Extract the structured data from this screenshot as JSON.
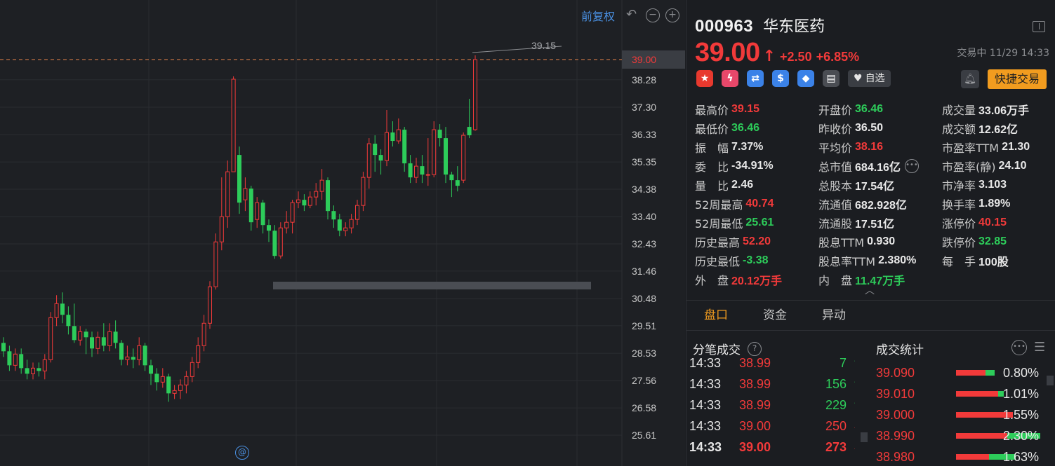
{
  "chart": {
    "adjust_label": "前复权",
    "undo_icon": "undo-icon",
    "zoom_out_icon": "zoom-out-icon",
    "zoom_in_icon": "zoom-in-icon",
    "marker_icon": "at-marker-icon",
    "high_annotation": "39.15",
    "last_price_label": "39.00",
    "colors": {
      "up": "#f23a3a",
      "down": "#2dcc5a",
      "grid": "#2a2c31",
      "dash": "#e8854a"
    },
    "axis_ticks": [
      "39.00",
      "38.28",
      "37.30",
      "36.33",
      "35.35",
      "34.38",
      "33.40",
      "32.43",
      "31.46",
      "30.48",
      "29.51",
      "28.53",
      "27.56",
      "26.58",
      "25.61"
    ]
  },
  "chart_data": {
    "type": "candlestick",
    "ylim": [
      25.61,
      39.15
    ],
    "candles": [
      {
        "o": 28.9,
        "c": 28.6,
        "h": 29.1,
        "l": 28.4
      },
      {
        "o": 28.6,
        "c": 28.1,
        "h": 28.8,
        "l": 27.9
      },
      {
        "o": 28.1,
        "c": 28.5,
        "h": 28.7,
        "l": 27.9
      },
      {
        "o": 28.5,
        "c": 28.0,
        "h": 28.7,
        "l": 27.8
      },
      {
        "o": 28.0,
        "c": 27.8,
        "h": 28.3,
        "l": 27.6
      },
      {
        "o": 27.8,
        "c": 28.0,
        "h": 28.2,
        "l": 27.6
      },
      {
        "o": 28.0,
        "c": 27.9,
        "h": 28.2,
        "l": 27.7
      },
      {
        "o": 27.9,
        "c": 28.3,
        "h": 28.5,
        "l": 27.6
      },
      {
        "o": 28.3,
        "c": 29.8,
        "h": 30.0,
        "l": 28.2
      },
      {
        "o": 29.8,
        "c": 30.3,
        "h": 30.6,
        "l": 29.5
      },
      {
        "o": 30.3,
        "c": 29.9,
        "h": 30.7,
        "l": 29.6
      },
      {
        "o": 29.9,
        "c": 29.5,
        "h": 30.2,
        "l": 29.2
      },
      {
        "o": 29.5,
        "c": 29.0,
        "h": 30.3,
        "l": 28.9
      },
      {
        "o": 29.0,
        "c": 29.3,
        "h": 29.5,
        "l": 28.8
      },
      {
        "o": 29.3,
        "c": 29.1,
        "h": 29.4,
        "l": 28.5
      },
      {
        "o": 29.1,
        "c": 28.7,
        "h": 29.3,
        "l": 28.4
      },
      {
        "o": 28.7,
        "c": 29.1,
        "h": 29.3,
        "l": 28.5
      },
      {
        "o": 29.1,
        "c": 28.8,
        "h": 29.6,
        "l": 28.6
      },
      {
        "o": 28.8,
        "c": 29.3,
        "h": 29.6,
        "l": 28.6
      },
      {
        "o": 29.3,
        "c": 28.9,
        "h": 29.7,
        "l": 28.7
      },
      {
        "o": 28.9,
        "c": 28.3,
        "h": 29.0,
        "l": 28.1
      },
      {
        "o": 28.3,
        "c": 28.4,
        "h": 28.8,
        "l": 28.1
      },
      {
        "o": 28.4,
        "c": 28.3,
        "h": 28.7,
        "l": 28.0
      },
      {
        "o": 28.3,
        "c": 28.8,
        "h": 29.1,
        "l": 28.1
      },
      {
        "o": 28.8,
        "c": 28.1,
        "h": 28.9,
        "l": 27.9
      },
      {
        "o": 28.1,
        "c": 27.8,
        "h": 28.3,
        "l": 27.4
      },
      {
        "o": 27.8,
        "c": 27.5,
        "h": 28.0,
        "l": 27.2
      },
      {
        "o": 27.5,
        "c": 27.7,
        "h": 28.0,
        "l": 27.3
      },
      {
        "o": 27.7,
        "c": 27.1,
        "h": 27.8,
        "l": 26.8
      },
      {
        "o": 27.1,
        "c": 27.2,
        "h": 27.4,
        "l": 26.9
      },
      {
        "o": 27.2,
        "c": 27.4,
        "h": 27.6,
        "l": 26.9
      },
      {
        "o": 27.4,
        "c": 27.7,
        "h": 27.9,
        "l": 27.1
      },
      {
        "o": 27.7,
        "c": 28.2,
        "h": 28.4,
        "l": 27.5
      },
      {
        "o": 28.2,
        "c": 28.8,
        "h": 29.1,
        "l": 28.0
      },
      {
        "o": 28.8,
        "c": 29.6,
        "h": 29.9,
        "l": 28.6
      },
      {
        "o": 29.6,
        "c": 30.9,
        "h": 31.1,
        "l": 29.4
      },
      {
        "o": 30.9,
        "c": 32.5,
        "h": 32.8,
        "l": 30.8
      },
      {
        "o": 32.5,
        "c": 33.4,
        "h": 34.8,
        "l": 32.2
      },
      {
        "o": 33.4,
        "c": 35.0,
        "h": 35.4,
        "l": 33.0
      },
      {
        "o": 35.0,
        "c": 38.3,
        "h": 38.4,
        "l": 35.0
      },
      {
        "o": 35.6,
        "c": 33.9,
        "h": 35.9,
        "l": 33.5
      },
      {
        "o": 34.0,
        "c": 34.4,
        "h": 34.8,
        "l": 33.6
      },
      {
        "o": 34.4,
        "c": 33.2,
        "h": 34.5,
        "l": 32.9
      },
      {
        "o": 33.3,
        "c": 33.9,
        "h": 34.1,
        "l": 33.0
      },
      {
        "o": 33.9,
        "c": 33.1,
        "h": 34.0,
        "l": 32.8
      },
      {
        "o": 33.1,
        "c": 32.9,
        "h": 33.3,
        "l": 32.5
      },
      {
        "o": 32.9,
        "c": 32.0,
        "h": 33.1,
        "l": 31.9
      },
      {
        "o": 32.0,
        "c": 33.0,
        "h": 33.2,
        "l": 31.9
      },
      {
        "o": 33.0,
        "c": 33.2,
        "h": 33.6,
        "l": 32.8
      },
      {
        "o": 33.2,
        "c": 33.9,
        "h": 34.0,
        "l": 32.8
      },
      {
        "o": 33.9,
        "c": 34.0,
        "h": 34.3,
        "l": 33.7
      },
      {
        "o": 34.0,
        "c": 33.8,
        "h": 34.2,
        "l": 33.6
      },
      {
        "o": 33.8,
        "c": 34.1,
        "h": 34.3,
        "l": 33.7
      },
      {
        "o": 34.1,
        "c": 34.3,
        "h": 34.6,
        "l": 33.8
      },
      {
        "o": 34.3,
        "c": 34.7,
        "h": 35.1,
        "l": 34.0
      },
      {
        "o": 34.7,
        "c": 33.6,
        "h": 34.8,
        "l": 33.3
      },
      {
        "o": 33.6,
        "c": 33.3,
        "h": 33.8,
        "l": 33.0
      },
      {
        "o": 33.3,
        "c": 32.9,
        "h": 33.5,
        "l": 32.7
      },
      {
        "o": 32.9,
        "c": 33.0,
        "h": 33.2,
        "l": 32.7
      },
      {
        "o": 33.0,
        "c": 33.3,
        "h": 33.5,
        "l": 32.8
      },
      {
        "o": 33.3,
        "c": 33.8,
        "h": 34.0,
        "l": 33.1
      },
      {
        "o": 33.8,
        "c": 34.8,
        "h": 35.0,
        "l": 33.6
      },
      {
        "o": 34.8,
        "c": 36.0,
        "h": 36.2,
        "l": 34.4
      },
      {
        "o": 36.0,
        "c": 35.6,
        "h": 36.3,
        "l": 35.0
      },
      {
        "o": 35.6,
        "c": 35.4,
        "h": 35.8,
        "l": 34.9
      },
      {
        "o": 35.4,
        "c": 36.4,
        "h": 37.2,
        "l": 35.2
      },
      {
        "o": 36.4,
        "c": 36.1,
        "h": 36.8,
        "l": 35.9
      },
      {
        "o": 36.1,
        "c": 36.5,
        "h": 36.9,
        "l": 36.0
      },
      {
        "o": 36.5,
        "c": 35.3,
        "h": 36.6,
        "l": 35.0
      },
      {
        "o": 35.3,
        "c": 34.8,
        "h": 35.6,
        "l": 34.6
      },
      {
        "o": 34.8,
        "c": 35.2,
        "h": 35.5,
        "l": 34.6
      },
      {
        "o": 35.2,
        "c": 34.9,
        "h": 35.6,
        "l": 34.6
      },
      {
        "o": 34.9,
        "c": 34.9,
        "h": 36.2,
        "l": 34.5
      },
      {
        "o": 34.9,
        "c": 36.5,
        "h": 36.8,
        "l": 34.8
      },
      {
        "o": 36.5,
        "c": 36.2,
        "h": 36.7,
        "l": 35.9
      },
      {
        "o": 36.2,
        "c": 34.9,
        "h": 36.6,
        "l": 34.6
      },
      {
        "o": 34.9,
        "c": 34.7,
        "h": 35.0,
        "l": 34.1
      },
      {
        "o": 34.7,
        "c": 34.5,
        "h": 35.2,
        "l": 34.3
      },
      {
        "o": 34.7,
        "c": 36.3,
        "h": 36.4,
        "l": 34.6
      },
      {
        "o": 36.6,
        "c": 36.3,
        "h": 37.6,
        "l": 36.2
      },
      {
        "o": 36.5,
        "c": 39.0,
        "h": 39.15,
        "l": 36.46
      }
    ]
  },
  "quote": {
    "code": "000963",
    "name": "华东医药",
    "price": "39.00",
    "arrow": "↑",
    "change": "+2.50",
    "change_pct": "+6.85%",
    "status": "交易中 11/29 14:33",
    "watch_label": "自选",
    "trade_label": "快捷交易",
    "badges": [
      {
        "icon": "china-flag-icon",
        "glyph": "★",
        "color": "#e8392e"
      },
      {
        "icon": "margin-lightning-icon",
        "glyph": "ϟ",
        "color": "#e8476a"
      },
      {
        "icon": "stock-connect-icon",
        "glyph": "⇄",
        "color": "#3b82e8"
      },
      {
        "icon": "dividend-dollar-icon",
        "glyph": "$",
        "color": "#3b82e8"
      },
      {
        "icon": "tag-icon",
        "glyph": "◆",
        "color": "#3b82e8"
      },
      {
        "icon": "document-icon",
        "glyph": "▤",
        "color": "#4a4d53"
      }
    ]
  },
  "stats": [
    [
      {
        "label": "最高价",
        "value": "39.15",
        "color": "red"
      },
      {
        "label": "开盘价",
        "value": "36.46",
        "color": "green"
      },
      {
        "label": "成交量",
        "value": "33.06万手",
        "color": "white"
      }
    ],
    [
      {
        "label": "最低价",
        "value": "36.46",
        "color": "green"
      },
      {
        "label": "昨收价",
        "value": "36.50",
        "color": "white"
      },
      {
        "label": "成交额",
        "value": "12.62亿",
        "color": "white"
      }
    ],
    [
      {
        "label": "振　幅",
        "value": "7.37%",
        "color": "white"
      },
      {
        "label": "平均价",
        "value": "38.16",
        "color": "red"
      },
      {
        "label": "市盈率TTM",
        "value": "21.30",
        "color": "white"
      }
    ],
    [
      {
        "label": "委　比",
        "value": "-34.91%",
        "color": "white"
      },
      {
        "label": "总市值",
        "value": "684.16亿",
        "color": "white"
      },
      {
        "label": "市盈率(静)",
        "value": "24.10",
        "color": "white"
      }
    ],
    [
      {
        "label": "量　比",
        "value": "2.46",
        "color": "white"
      },
      {
        "label": "总股本",
        "value": "17.54亿",
        "color": "white"
      },
      {
        "label": "市净率",
        "value": "3.103",
        "color": "white"
      }
    ],
    [
      {
        "label": "52周最高",
        "value": "40.74",
        "color": "red"
      },
      {
        "label": "流通值",
        "value": "682.928亿",
        "color": "white"
      },
      {
        "label": "换手率",
        "value": "1.89%",
        "color": "white"
      }
    ],
    [
      {
        "label": "52周最低",
        "value": "25.61",
        "color": "green"
      },
      {
        "label": "流通股",
        "value": "17.51亿",
        "color": "white"
      },
      {
        "label": "涨停价",
        "value": "40.15",
        "color": "red"
      }
    ],
    [
      {
        "label": "历史最高",
        "value": "52.20",
        "color": "red"
      },
      {
        "label": "股息TTM",
        "value": "0.930",
        "color": "white"
      },
      {
        "label": "跌停价",
        "value": "32.85",
        "color": "green"
      }
    ],
    [
      {
        "label": "历史最低",
        "value": "-3.38",
        "color": "green"
      },
      {
        "label": "股息率TTM",
        "value": "2.380%",
        "color": "white"
      },
      {
        "label": "每　手",
        "value": "100股",
        "color": "white"
      }
    ],
    [
      {
        "label": "外　盘",
        "value": "20.12万手",
        "color": "red"
      },
      {
        "label": "内　盘",
        "value": "11.47万手",
        "color": "green"
      },
      {
        "label": "",
        "value": "",
        "color": "white"
      }
    ]
  ],
  "tabs": [
    "盘口",
    "资金",
    "异动"
  ],
  "ticks": {
    "title": "分笔成交",
    "rows": [
      {
        "time": "14:33",
        "price": "38.99",
        "vol": "7",
        "dir": "down"
      },
      {
        "time": "14:33",
        "price": "38.99",
        "vol": "156",
        "dir": "down"
      },
      {
        "time": "14:33",
        "price": "38.99",
        "vol": "229",
        "dir": "down"
      },
      {
        "time": "14:33",
        "price": "39.00",
        "vol": "250",
        "dir": "up"
      },
      {
        "time": "14:33",
        "price": "39.00",
        "vol": "273",
        "dir": "up"
      }
    ]
  },
  "volume_profile": {
    "title": "成交统计",
    "rows": [
      {
        "price": "39.090",
        "pct": "0.80%",
        "red": 0.8,
        "green": 0.25
      },
      {
        "price": "39.010",
        "pct": "1.01%",
        "red": 1.15,
        "green": 0.15
      },
      {
        "price": "39.000",
        "pct": "1.55%",
        "red": 1.55,
        "green": 0.0
      },
      {
        "price": "38.990",
        "pct": "2.30%",
        "red": 1.4,
        "green": 0.9
      },
      {
        "price": "38.980",
        "pct": "1.63%",
        "red": 0.9,
        "green": 0.73
      }
    ]
  }
}
